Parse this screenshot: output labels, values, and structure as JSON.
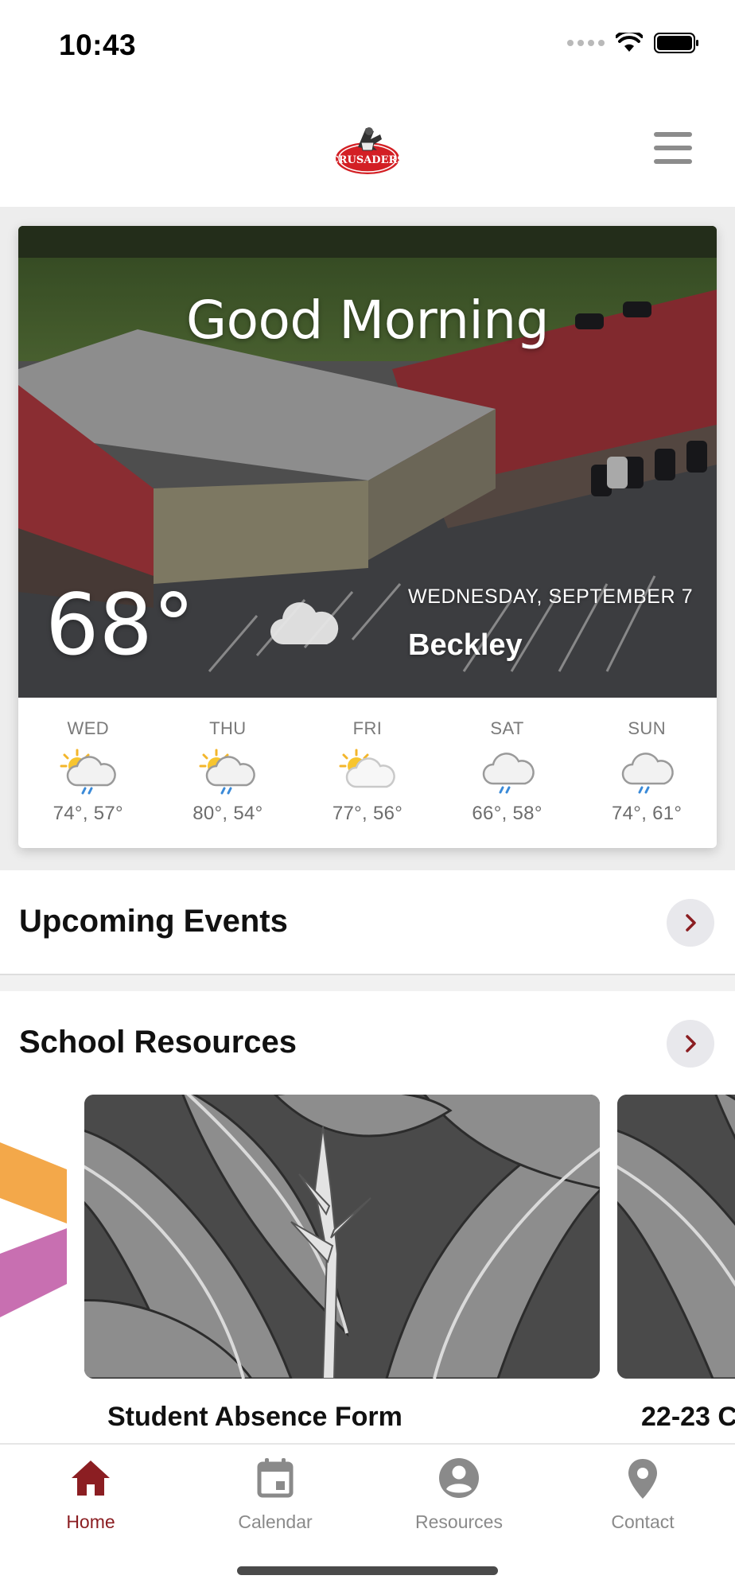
{
  "status_bar": {
    "time": "10:43"
  },
  "header": {
    "logo_text": "CRUSADERS",
    "menu_icon": "hamburger-menu-icon"
  },
  "weather": {
    "greeting": "Good Morning",
    "current_temp": "68°",
    "current_icon": "cloud-icon",
    "date": "WEDNESDAY, SEPTEMBER 7",
    "city": "Beckley",
    "forecast": [
      {
        "day": "WED",
        "temps": "74°, 57°",
        "icon": "partly-sunny-rain-icon"
      },
      {
        "day": "THU",
        "temps": "80°, 54°",
        "icon": "partly-sunny-rain-icon"
      },
      {
        "day": "FRI",
        "temps": "77°, 56°",
        "icon": "partly-sunny-icon"
      },
      {
        "day": "SAT",
        "temps": "66°, 58°",
        "icon": "cloud-rain-icon"
      },
      {
        "day": "SUN",
        "temps": "74°, 61°",
        "icon": "cloud-rain-icon"
      }
    ]
  },
  "sections": {
    "upcoming_events": {
      "title": "Upcoming Events"
    },
    "school_resources": {
      "title": "School Resources"
    }
  },
  "resources": [
    {
      "title": "Student Absence Form"
    },
    {
      "title": "22-23 C"
    }
  ],
  "tabs": [
    {
      "label": "Home",
      "icon": "home-icon",
      "active": true
    },
    {
      "label": "Calendar",
      "icon": "calendar-icon",
      "active": false
    },
    {
      "label": "Resources",
      "icon": "account-circle-icon",
      "active": false
    },
    {
      "label": "Contact",
      "icon": "location-pin-icon",
      "active": false
    }
  ],
  "colors": {
    "accent": "#8b1e22",
    "chevron_bg": "#e8e8ec",
    "inactive_tab": "#8a8a8a"
  }
}
